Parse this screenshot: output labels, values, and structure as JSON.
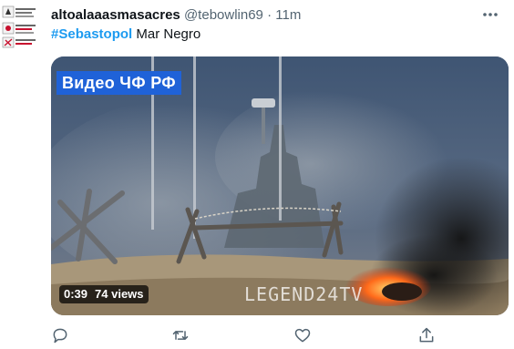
{
  "tweet": {
    "author_name": "altoalaaasmasacres",
    "handle": "@tebowlin69",
    "separator": "·",
    "time": "11m",
    "hashtag": "#Sebastopol",
    "text_rest": " Mar Negro",
    "video": {
      "channel_badge": "Видео ЧФ РФ",
      "duration": "0:39",
      "views": "74 views",
      "watermark": "LEGEND24TV"
    }
  },
  "icons": {
    "more": "more-horizontal-icon",
    "reply": "reply-icon",
    "retweet": "retweet-icon",
    "like": "like-icon",
    "share": "share-icon"
  },
  "colors": {
    "text": "#0f1419",
    "secondary": "#536471",
    "accent": "#1d9bf0",
    "badge": "#1f62d8"
  }
}
